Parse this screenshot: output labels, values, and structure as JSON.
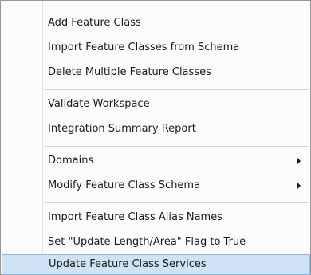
{
  "menu": {
    "items": [
      {
        "label": "Add Feature Class",
        "submenu": false,
        "highlighted": false
      },
      {
        "label": "Import Feature Classes from Schema",
        "submenu": false,
        "highlighted": false
      },
      {
        "label": "Delete Multiple Feature Classes",
        "submenu": false,
        "highlighted": false
      },
      {
        "label": "Validate Workspace",
        "submenu": false,
        "highlighted": false
      },
      {
        "label": "Integration Summary Report",
        "submenu": false,
        "highlighted": false
      },
      {
        "label": "Domains",
        "submenu": true,
        "highlighted": false
      },
      {
        "label": "Modify Feature Class Schema",
        "submenu": true,
        "highlighted": false
      },
      {
        "label": "Import Feature Class Alias Names",
        "submenu": false,
        "highlighted": false
      },
      {
        "label": "Set \"Update Length/Area\" Flag to True",
        "submenu": false,
        "highlighted": false
      },
      {
        "label": "Update Feature Class Services",
        "submenu": false,
        "highlighted": true
      }
    ]
  },
  "colors": {
    "menu_background": "#fcfcfc",
    "highlight_fill": "#cfe2f6",
    "highlight_border": "#8fb5e0",
    "separator": "#d7d7d7"
  }
}
